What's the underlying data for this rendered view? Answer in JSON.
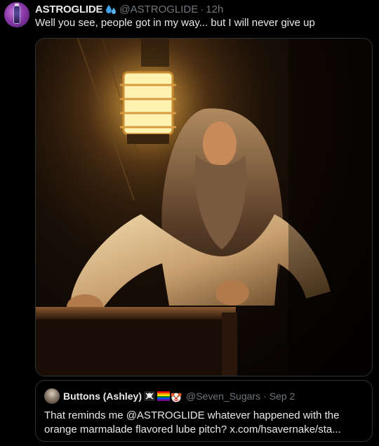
{
  "post": {
    "author": {
      "display_name": "ASTROGLIDE",
      "handle": "@ASTROGLIDE",
      "avatar_icon": "astroglide-bottle-avatar",
      "badge_icon": "water-drops-emoji"
    },
    "time": "12h",
    "separator": "·",
    "text": "Well you see, people got in my way... but I will never give up",
    "media": {
      "type": "photo",
      "icon": "bearded-man-lantern-photo"
    }
  },
  "quoted_post": {
    "author": {
      "display_name": "Buttons (Ashley)",
      "handle": "@Seven_Sugars",
      "avatar_icon": "user-avatar",
      "emojis": [
        "skull-crossbones-emoji",
        "rainbow-flag-emoji",
        "clown-face-emoji"
      ]
    },
    "time": "Sep 2",
    "separator": "·",
    "text": "That reminds me @ASTROGLIDE whatever happened with the orange marmalade flavored lube pitch? x.com/hsavernake/sta..."
  },
  "colors": {
    "background": "#000000",
    "text_primary": "#e7e9ea",
    "text_secondary": "#71767b",
    "border": "#2f3336"
  }
}
